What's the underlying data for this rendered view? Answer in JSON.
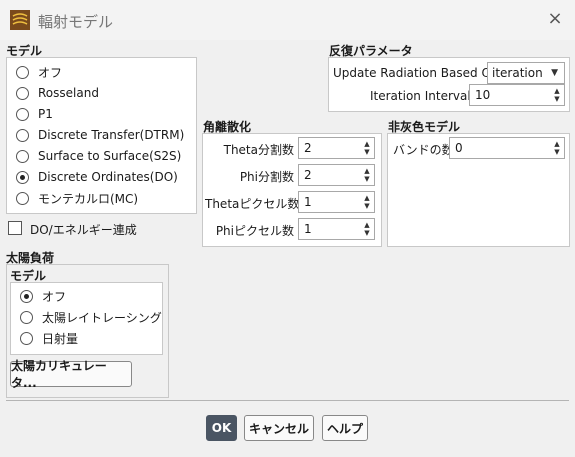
{
  "window": {
    "title": "輻射モデル",
    "close_icon": "×"
  },
  "model": {
    "title": "モデル",
    "options": [
      {
        "label": "オフ",
        "checked": false
      },
      {
        "label": "Rosseland",
        "checked": false
      },
      {
        "label": "P1",
        "checked": false
      },
      {
        "label": "Discrete Transfer(DTRM)",
        "checked": false
      },
      {
        "label": "Surface to Surface(S2S)",
        "checked": false
      },
      {
        "label": "Discrete Ordinates(DO)",
        "checked": true
      },
      {
        "label": "モンテカルロ(MC)",
        "checked": false
      }
    ],
    "do_energy_coupling": "DO/エネルギー連成"
  },
  "iteration_params": {
    "title": "反復パラメータ",
    "update_label": "Update Radiation Based On",
    "update_value": "iteration",
    "interval_label": "Iteration Interval",
    "interval_value": "10"
  },
  "angular": {
    "title": "角離散化",
    "fields": [
      {
        "label": "Theta分割数",
        "value": "2"
      },
      {
        "label": "Phi分割数",
        "value": "2"
      },
      {
        "label": "Thetaピクセル数",
        "value": "1"
      },
      {
        "label": "Phiピクセル数",
        "value": "1"
      }
    ]
  },
  "nongray": {
    "title": "非灰色モデル",
    "band_label": "バンドの数",
    "band_value": "0"
  },
  "solar": {
    "title": "太陽負荷",
    "model_title": "モデル",
    "options": [
      {
        "label": "オフ",
        "checked": true
      },
      {
        "label": "太陽レイトレーシング",
        "checked": false
      },
      {
        "label": "日射量",
        "checked": false
      }
    ],
    "calculator_button": "太陽カリキュレータ..."
  },
  "footer": {
    "ok": "OK",
    "cancel": "キャンセル",
    "help": "ヘルプ"
  }
}
